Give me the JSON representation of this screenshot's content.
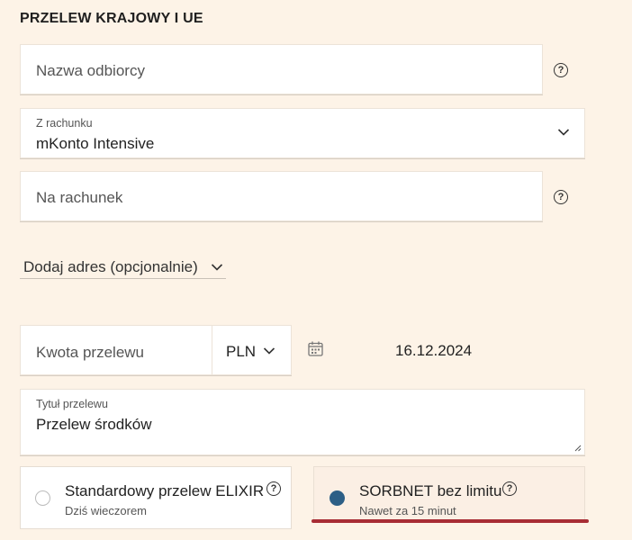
{
  "form": {
    "title": "PRZELEW KRAJOWY I UE",
    "recipient": {
      "placeholder": "Nazwa odbiorcy"
    },
    "from_account": {
      "label": "Z rachunku",
      "value": "mKonto Intensive"
    },
    "to_account": {
      "placeholder": "Na rachunek"
    },
    "add_address": {
      "label": "Dodaj adres (opcjonalnie)"
    },
    "amount": {
      "placeholder": "Kwota przelewu",
      "currency": "PLN"
    },
    "date": {
      "value": "16.12.2024"
    },
    "transfer_title": {
      "label": "Tytuł przelewu",
      "value": "Przelew środków"
    },
    "help_glyph": "?",
    "options": [
      {
        "title": "Standardowy przelew ELIXIR",
        "subtitle": "Dziś wieczorem",
        "selected": false
      },
      {
        "title": "SORBNET bez limitu",
        "subtitle": "Nawet za 15 minut",
        "selected": true
      }
    ]
  },
  "colors": {
    "background": "#fdf3e7",
    "selected_radio": "#2d5f86",
    "underline": "#a82d35"
  }
}
